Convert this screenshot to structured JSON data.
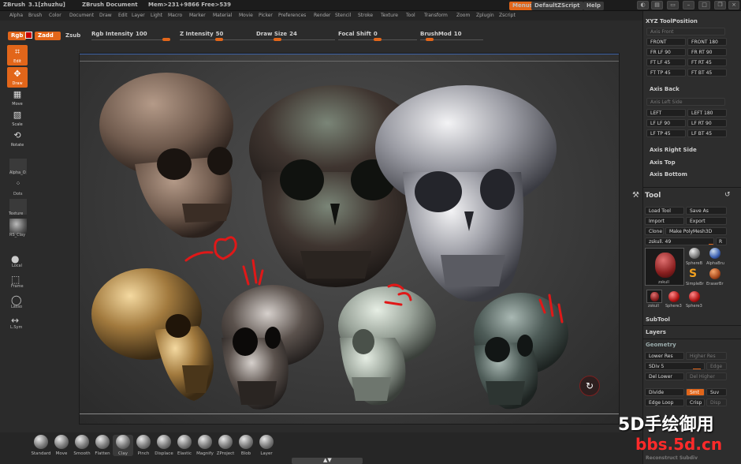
{
  "titlebar": {
    "app": "ZBrush",
    "version": "3.1[zhuzhu]",
    "document": "ZBrush Document",
    "mem": "Mem>231+9866 Free>539",
    "menus_btn": "Menus",
    "script_btn": "DefaultZScript",
    "help_btn": "Help"
  },
  "menubar": {
    "items": [
      "Alpha",
      "Brush",
      "Color",
      "Document",
      "Draw",
      "Edit",
      "Layer",
      "Light",
      "Macro",
      "Marker",
      "Material",
      "Movie",
      "Picker",
      "Preferences",
      "Render",
      "Stencil",
      "Stroke",
      "Texture",
      "Tool",
      "Transform",
      "Zoom",
      "Zplugin",
      "Zscript"
    ]
  },
  "topbar": {
    "rgb": "Rgb",
    "zadd": "Zadd",
    "zsub": "Zsub",
    "sliders": [
      {
        "label": "Rgb Intensity",
        "value": "100",
        "fill": 1.0
      },
      {
        "label": "Z Intensity",
        "value": "50",
        "fill": 0.5
      },
      {
        "label": "Draw Size",
        "value": "24",
        "fill": 0.24
      },
      {
        "label": "Focal Shift",
        "value": "0",
        "fill": 0.5
      },
      {
        "label": "BrushMod",
        "value": "10",
        "fill": 0.1
      }
    ]
  },
  "lefttools": {
    "items": [
      {
        "label": "Edit",
        "icon": "edit-icon",
        "active": true
      },
      {
        "label": "Draw",
        "icon": "draw-icon",
        "active": true
      },
      {
        "label": "Move",
        "icon": "move-icon",
        "active": false
      },
      {
        "label": "Scale",
        "icon": "scale-icon",
        "active": false
      },
      {
        "label": "Rotate",
        "icon": "rotate-icon",
        "active": false
      }
    ],
    "alpha_label": "Alpha_O",
    "dots_label": "Dots",
    "texture_label": "Texture",
    "material_label": "RS_Clay",
    "local_label": "Local",
    "frame_label": "Frame",
    "lasso_label": "Lasso",
    "lsym_label": "L.Sym"
  },
  "bottombar": {
    "brushes": [
      "Standard",
      "Move",
      "Smooth",
      "Flatten",
      "Clay",
      "Pinch",
      "Displace",
      "Elastic",
      "Magnify",
      "ZProject",
      "Blob",
      "Layer"
    ]
  },
  "rightpanel": {
    "xyz_title": "XYZ ToolPosition",
    "axis_front": "Axis Front",
    "front_buttons": [
      "FRONT",
      "FRONT 180",
      "FR LF 90",
      "FR RT 90",
      "FT LF 45",
      "FT RT 45",
      "FT TP 45",
      "FT BT 45"
    ],
    "axis_back": "Axis Back",
    "axis_left_side": "Axis Left Side",
    "left_buttons": [
      "LEFT",
      "LEFT 180",
      "LF LF 90",
      "LF RT 90",
      "LF TP 45",
      "LF BT 45"
    ],
    "axis_right_side": "Axis Right Side",
    "axis_top": "Axis Top",
    "axis_bottom": "Axis Bottom",
    "tool_title": "Tool",
    "tool_buttons": [
      "Load Tool",
      "Save As",
      "Import",
      "Export",
      "Clone",
      "Make PolyMesh3D"
    ],
    "tool_slider": {
      "label": "zskull. 49",
      "r": "R"
    },
    "thumbs": [
      "zskull",
      "SphereB",
      "AlphaBru",
      "SimpleBr",
      "EraserBr",
      "zskull",
      "Sphere3",
      "Sphere3"
    ],
    "subtool": "SubTool",
    "layers": "Layers",
    "geometry": "Geometry",
    "lower_res": "Lower Res",
    "higher_res": "Higher Res",
    "sdiv": "SDiv 5",
    "edge": "Edge",
    "del_lower": "Del Lower",
    "del_higher": "Del Higher",
    "divide": "Divide",
    "smt": "Smt",
    "suv": "Suv",
    "edge_loop": "Edge Loop",
    "crisp": "Crisp",
    "disp": "Disp",
    "reconstruct": "Reconstruct Subdiv"
  },
  "watermark": {
    "line1": "5D手绘御用",
    "line2": "bbs.5d.cn"
  },
  "colors": {
    "accent": "#e2661a",
    "panel": "#2d2d2d",
    "canvas": "#3b3b3b"
  }
}
